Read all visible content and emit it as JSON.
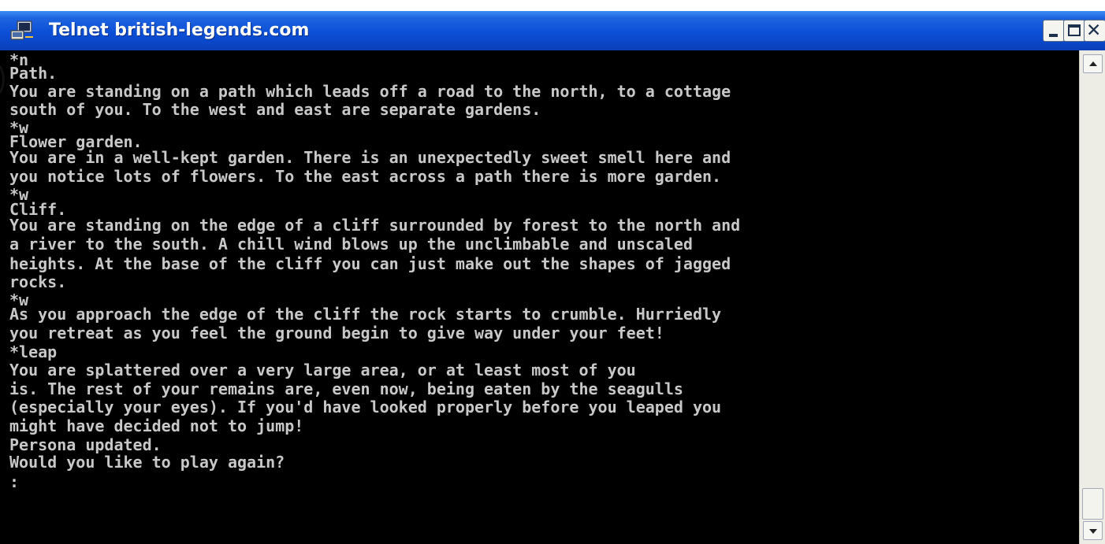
{
  "window": {
    "title": "Telnet british-legends.com",
    "icon": "telnet-app-icon",
    "controls": [
      "minimize",
      "maximize",
      "close"
    ]
  },
  "colors": {
    "titlebar": "#0b4fd7",
    "terminal_bg": "#000000",
    "terminal_fg": "#c8c8c8"
  },
  "terminal": {
    "lines": [
      "*n",
      "Path.",
      "You are standing on a path which leads off a road to the north, to a cottage",
      "south of you. To the west and east are separate gardens.",
      "*w",
      "Flower garden.",
      "You are in a well-kept garden. There is an unexpectedly sweet smell here and",
      "you notice lots of flowers. To the east across a path there is more garden.",
      "*w",
      "Cliff.",
      "You are standing on the edge of a cliff surrounded by forest to the north and",
      "a river to the south. A chill wind blows up the unclimbable and unscaled",
      "heights. At the base of the cliff you can just make out the shapes of jagged",
      "rocks.",
      "*w",
      "As you approach the edge of the cliff the rock starts to crumble. Hurriedly",
      "you retreat as you feel the ground begin to give way under your feet!",
      "*leap",
      "You are splattered over a very large area, or at least most of you",
      "is. The rest of your remains are, even now, being eaten by the seagulls",
      "(especially your eyes). If you'd have looked properly before you leaped you",
      "might have decided not to jump!",
      "Persona updated.",
      "Would you like to play again?",
      ":"
    ]
  },
  "scrollbar": {
    "position": 0.95
  }
}
